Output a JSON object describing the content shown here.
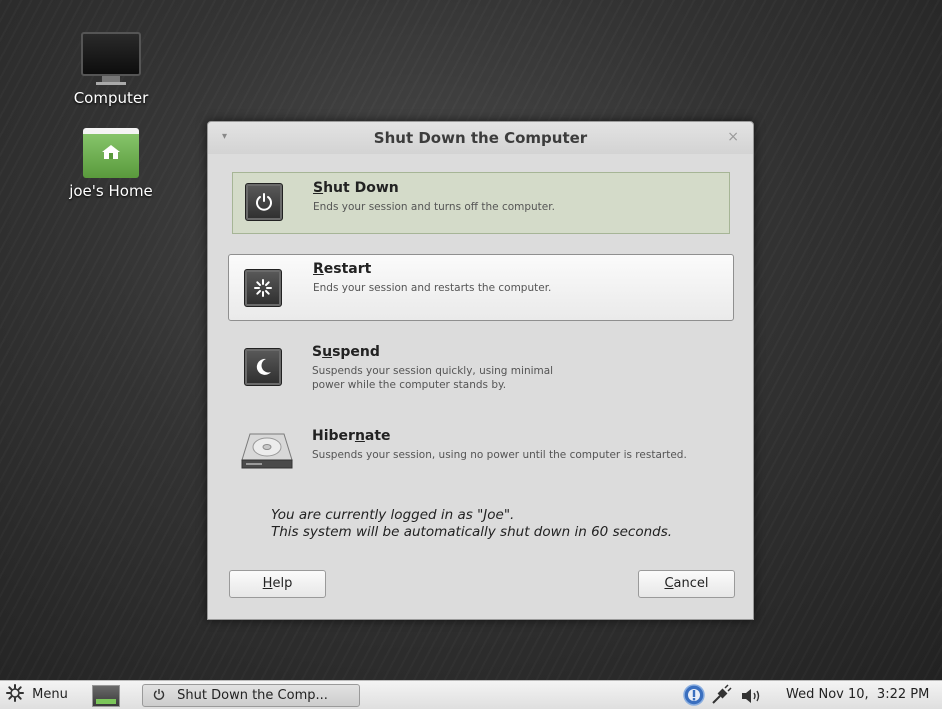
{
  "desktop": {
    "icons": [
      {
        "label": "Computer",
        "icon": "monitor-icon"
      },
      {
        "label": "joe's Home",
        "icon": "home-folder-icon"
      }
    ]
  },
  "dialog": {
    "title": "Shut Down the Computer",
    "close_glyph": "×",
    "menu_glyph": "▾",
    "options": [
      {
        "pre": "",
        "mnemonic": "S",
        "post": "hut Down",
        "description": "Ends your session and turns off the computer.",
        "icon": "power-icon",
        "state": "selected"
      },
      {
        "pre": "",
        "mnemonic": "R",
        "post": "estart",
        "description": "Ends your session and restarts the computer.",
        "icon": "restart-icon",
        "state": "hover"
      },
      {
        "pre": "S",
        "mnemonic": "u",
        "post": "spend",
        "description_line1": "Suspends your session quickly, using minimal",
        "description_line2": "power while the computer stands by.",
        "icon": "suspend-moon-icon",
        "state": "normal"
      },
      {
        "pre": "Hiber",
        "mnemonic": "n",
        "post": "ate",
        "description": "Suspends your session, using no power until the computer is restarted.",
        "icon": "hard-disk-icon",
        "state": "normal"
      }
    ],
    "message_line1": "You are currently logged in as \"Joe\".",
    "message_line2": "This system will be automatically shut down in 60 seconds.",
    "help_button": {
      "mnemonic": "H",
      "rest": "elp"
    },
    "cancel_button": {
      "mnemonic": "C",
      "rest": "ancel"
    }
  },
  "taskbar": {
    "menu_label": "Menu",
    "task_label": "Shut Down the Comp...",
    "clock": "Wed Nov 10,  3:22 PM"
  },
  "colors": {
    "selected_bg": "#d4dbc9",
    "folder_green": "#6fb04f"
  }
}
